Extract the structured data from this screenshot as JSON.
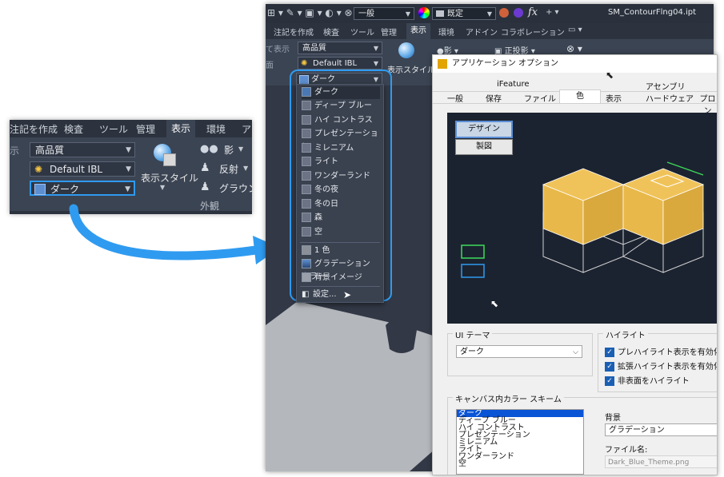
{
  "left_ribbon": {
    "tabs": [
      "注記を作成",
      "検査",
      "ツール",
      "管理",
      "表示",
      "環境",
      "ア"
    ],
    "active_tab": "表示",
    "side_label": "示",
    "quality_combo": "高品質",
    "ibl_combo": "Default IBL",
    "theme_combo": "ダーク",
    "display_style_label": "表示スタイル",
    "shadow_label": "影",
    "reflection_label": "反射",
    "ground_label": "グラウント",
    "appearance_group": "外観"
  },
  "main_app": {
    "window_title": "SM_ContourFlng04.ipt",
    "toolbar_combo1": "一般",
    "toolbar_combo2": "既定",
    "fx_label": "fx",
    "ribbon_tabs": [
      "注記を作成",
      "検査",
      "ツール",
      "管理",
      "表示",
      "環境",
      "アドイン",
      "コラボレーション"
    ],
    "active_tab": "表示",
    "side_label1": "て表示",
    "side_label2": "面",
    "quality_combo": "高品質",
    "ibl_combo": "Default IBL",
    "theme_combo": "ダーク",
    "display_style_label": "表示スタイル",
    "shadow_label": "影",
    "projection_label": "正投影"
  },
  "dropdown": {
    "themes": [
      "ダーク",
      "ディープ ブルー",
      "ハイ コントラスト",
      "プレゼンテーション",
      "ミレニアム",
      "ライト",
      "ワンダーランド",
      "冬の夜",
      "冬の日",
      "森",
      "空"
    ],
    "selected": "ダーク",
    "background_options": [
      "1 色",
      "グラデーション カラー",
      "背景イメージ"
    ],
    "settings_label": "設定..."
  },
  "dialog": {
    "title": "アプリケーション オプション",
    "tabs_row1": [
      "iFeature",
      "アセンブリ"
    ],
    "tabs_row2": [
      "一般",
      "保存",
      "ファイル",
      "色",
      "表示",
      "ハードウェア",
      "プロン"
    ],
    "active_tab": "色",
    "preview_buttons": [
      "デザイン",
      "製図"
    ],
    "ui_theme_group": "UI テーマ",
    "ui_theme_value": "ダーク",
    "highlight_group": "ハイライト",
    "highlight_options": [
      "プレハイライト表示を有効化",
      "拡張ハイライト表示を有効化",
      "非表面をハイライト"
    ],
    "canvas_scheme_group": "キャンバス内カラー スキーム",
    "canvas_schemes": [
      "ダーク",
      "ディープ ブルー",
      "ハイ コントラスト",
      "プレゼンテーション",
      "ミレニアム",
      "ライト",
      "ワンダーランド",
      "空"
    ],
    "background_label": "背景",
    "background_value": "グラデーション",
    "filename_label": "ファイル名:",
    "filename_value": "Dark_Blue_Theme.png"
  },
  "colors": {
    "ribbon_bg": "#3b4453",
    "accent_blue": "#2f9bf0",
    "box_yellow": "#e8b84a",
    "preview_bg": "#1c2330"
  }
}
